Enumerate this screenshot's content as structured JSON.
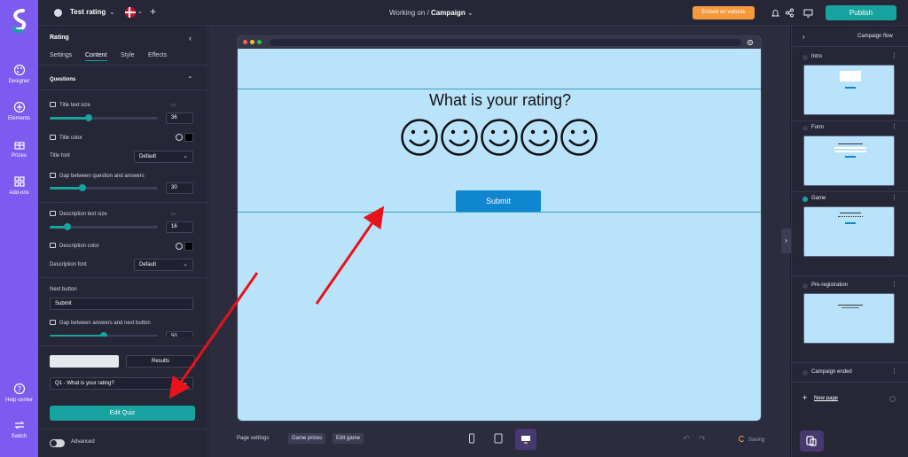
{
  "topbar": {
    "project_name": "Test rating",
    "working_label": "Working on",
    "separator": "/",
    "working_value": "Campaign",
    "embed_label": "Embed on website",
    "publish_label": "Publish"
  },
  "rail": {
    "items": [
      {
        "label": "Designer",
        "icon": "palette-icon"
      },
      {
        "label": "Elements",
        "icon": "plus-circle-icon"
      },
      {
        "label": "Prizes",
        "icon": "gift-icon"
      },
      {
        "label": "Add-ons",
        "icon": "grid-icon"
      }
    ],
    "help": "Help center",
    "switch": "Switch"
  },
  "panel": {
    "title": "Rating",
    "tabs": [
      "Settings",
      "Content",
      "Style",
      "Effects"
    ],
    "active_tab": "Content",
    "section": "Questions",
    "title_text_size_label": "Title text size",
    "title_text_size_value": "36",
    "title_text_size_fraction": 0.36,
    "title_color_label": "Title color",
    "title_font_label": "Title font",
    "title_font_value": "Default",
    "gap_qa_label": "Gap between question and answers",
    "gap_qa_value": "30",
    "gap_qa_fraction": 0.3,
    "desc_text_size_label": "Description text size",
    "desc_text_size_value": "16",
    "desc_text_size_fraction": 0.16,
    "desc_color_label": "Description color",
    "desc_font_label": "Description font",
    "desc_font_value": "Default",
    "next_button_label": "Next button",
    "next_button_value": "Submit",
    "gap_next_label": "Gap between answers and next button",
    "gap_next_value": "50",
    "gap_next_fraction": 0.5,
    "seg_left": "Questions",
    "seg_right": "Results",
    "question_select": "Q1 - What is your rating?",
    "edit_quiz": "Edit Quiz",
    "advanced": "Advanced",
    "px_unit": "px"
  },
  "canvas": {
    "question": "What is your rating?",
    "faces": [
      "☺",
      "☺",
      "☺",
      "☺",
      "☺"
    ],
    "submit_label": "Submit",
    "bg_color": "#b8e3fa",
    "button_color": "#0f86cf"
  },
  "bottom": {
    "page_settings": "Page settings",
    "game_prizes": "Game prizes",
    "edit_game": "Edit game",
    "saving": "Saving"
  },
  "flow": {
    "title": "Campaign flow",
    "pages": [
      {
        "name": "Intro",
        "active": false
      },
      {
        "name": "Form",
        "active": false
      },
      {
        "name": "Game",
        "active": true
      },
      {
        "name": "Pre-registration",
        "active": false
      },
      {
        "name": "Campaign ended",
        "active": false
      }
    ],
    "new_page": "New page"
  },
  "colors": {
    "accent": "#17a3a0",
    "brand": "#7d5bf0",
    "embed": "#f5993b",
    "arrow": "#e8131a"
  }
}
